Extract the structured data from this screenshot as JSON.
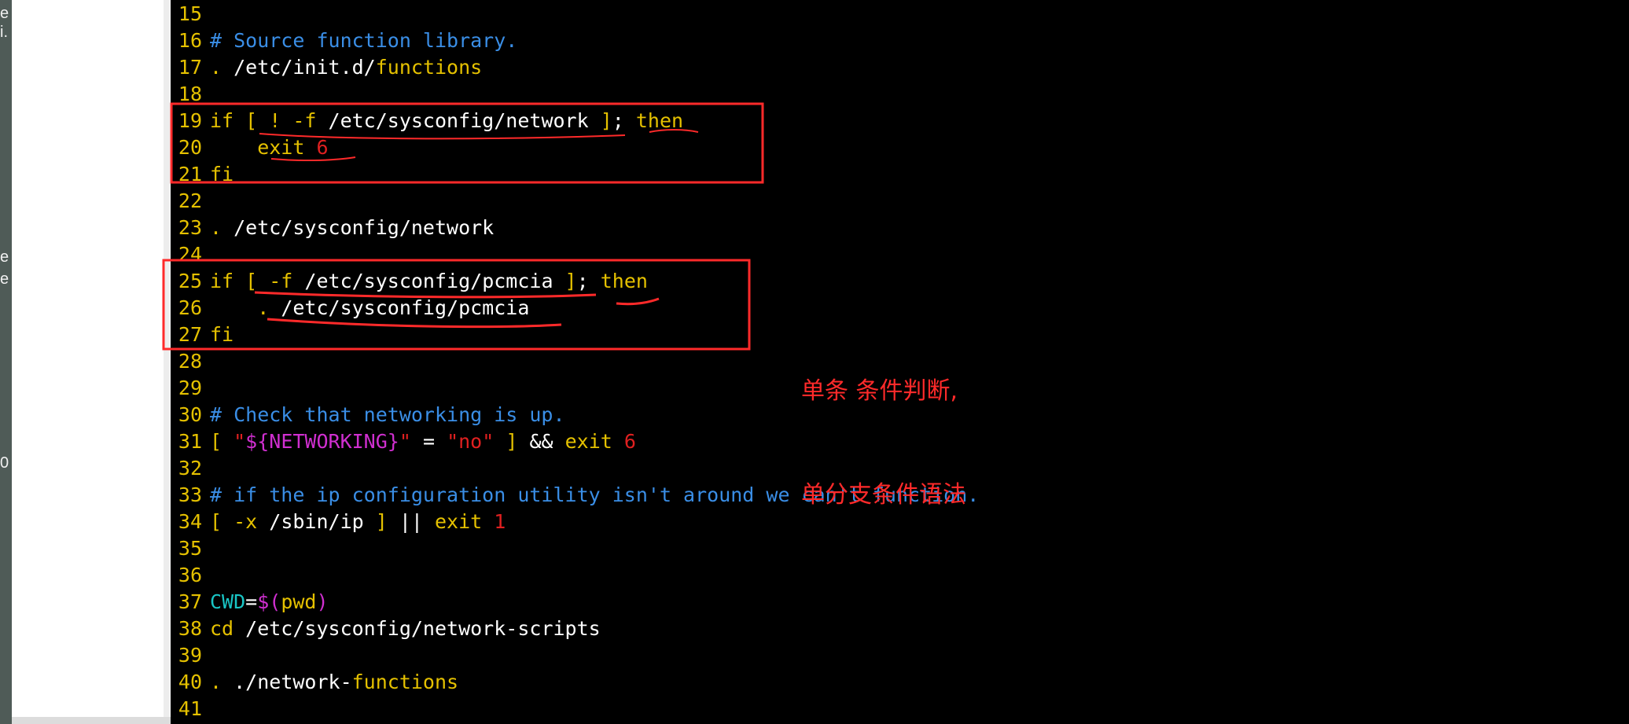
{
  "left_fragments": [
    {
      "text": "e"
    },
    {
      "text": "i."
    },
    {
      "text": "e"
    },
    {
      "text": "e"
    },
    {
      "text": "0"
    }
  ],
  "lines": [
    {
      "num": "15",
      "segs": []
    },
    {
      "num": "16",
      "segs": [
        {
          "t": "# Source function library.",
          "c": "c-blue"
        }
      ]
    },
    {
      "num": "17",
      "segs": [
        {
          "t": ". ",
          "c": "c-yellow"
        },
        {
          "t": "/etc/init.d/",
          "c": "c-white"
        },
        {
          "t": "functions",
          "c": "c-yellow"
        }
      ]
    },
    {
      "num": "18",
      "segs": []
    },
    {
      "num": "19",
      "segs": [
        {
          "t": "if ",
          "c": "c-yellow"
        },
        {
          "t": "[ ! -f ",
          "c": "c-yellow"
        },
        {
          "t": "/etc/sysconfig/network",
          "c": "c-white"
        },
        {
          "t": " ]",
          "c": "c-yellow"
        },
        {
          "t": "; ",
          "c": "c-white"
        },
        {
          "t": "then",
          "c": "c-yellow"
        }
      ]
    },
    {
      "num": "20",
      "segs": [
        {
          "t": "    exit ",
          "c": "c-yellow"
        },
        {
          "t": "6",
          "c": "c-red"
        }
      ]
    },
    {
      "num": "21",
      "segs": [
        {
          "t": "fi",
          "c": "c-yellow"
        }
      ]
    },
    {
      "num": "22",
      "segs": []
    },
    {
      "num": "23",
      "segs": [
        {
          "t": ". ",
          "c": "c-yellow"
        },
        {
          "t": "/etc/sysconfig/network",
          "c": "c-white"
        }
      ]
    },
    {
      "num": "24",
      "segs": []
    },
    {
      "num": "25",
      "segs": [
        {
          "t": "if ",
          "c": "c-yellow"
        },
        {
          "t": "[ -f ",
          "c": "c-yellow"
        },
        {
          "t": "/etc/sysconfig/pcmcia",
          "c": "c-white"
        },
        {
          "t": " ]",
          "c": "c-yellow"
        },
        {
          "t": "; ",
          "c": "c-white"
        },
        {
          "t": "then",
          "c": "c-yellow"
        }
      ]
    },
    {
      "num": "26",
      "segs": [
        {
          "t": "    . ",
          "c": "c-yellow"
        },
        {
          "t": "/etc/sysconfig/pcmcia",
          "c": "c-white"
        }
      ]
    },
    {
      "num": "27",
      "segs": [
        {
          "t": "fi",
          "c": "c-yellow"
        }
      ]
    },
    {
      "num": "28",
      "segs": []
    },
    {
      "num": "29",
      "segs": []
    },
    {
      "num": "30",
      "segs": [
        {
          "t": "# Check that networking is up.",
          "c": "c-blue"
        }
      ]
    },
    {
      "num": "31",
      "segs": [
        {
          "t": "[ ",
          "c": "c-yellow"
        },
        {
          "t": "\"",
          "c": "c-red"
        },
        {
          "t": "${NETWORKING}",
          "c": "c-magenta"
        },
        {
          "t": "\"",
          "c": "c-red"
        },
        {
          "t": " = ",
          "c": "c-white"
        },
        {
          "t": "\"no\"",
          "c": "c-red"
        },
        {
          "t": " ] ",
          "c": "c-yellow"
        },
        {
          "t": "&& ",
          "c": "c-white"
        },
        {
          "t": "exit ",
          "c": "c-yellow"
        },
        {
          "t": "6",
          "c": "c-red"
        }
      ]
    },
    {
      "num": "32",
      "segs": []
    },
    {
      "num": "33",
      "segs": [
        {
          "t": "# if the ip configuration utility isn't around we can't function.",
          "c": "c-blue"
        }
      ]
    },
    {
      "num": "34",
      "segs": [
        {
          "t": "[ -x ",
          "c": "c-yellow"
        },
        {
          "t": "/sbin/ip",
          "c": "c-white"
        },
        {
          "t": " ] ",
          "c": "c-yellow"
        },
        {
          "t": "|| ",
          "c": "c-white"
        },
        {
          "t": "exit ",
          "c": "c-yellow"
        },
        {
          "t": "1",
          "c": "c-red"
        }
      ]
    },
    {
      "num": "35",
      "segs": []
    },
    {
      "num": "36",
      "segs": []
    },
    {
      "num": "37",
      "segs": [
        {
          "t": "CWD",
          "c": "c-cyan"
        },
        {
          "t": "=",
          "c": "c-white"
        },
        {
          "t": "$(",
          "c": "c-magenta"
        },
        {
          "t": "pwd",
          "c": "c-yellow"
        },
        {
          "t": ")",
          "c": "c-magenta"
        }
      ]
    },
    {
      "num": "38",
      "segs": [
        {
          "t": "cd ",
          "c": "c-yellow"
        },
        {
          "t": "/etc/sysconfig/network-scripts",
          "c": "c-white"
        }
      ]
    },
    {
      "num": "39",
      "segs": []
    },
    {
      "num": "40",
      "segs": [
        {
          "t": ". ",
          "c": "c-yellow"
        },
        {
          "t": "./network-",
          "c": "c-white"
        },
        {
          "t": "functions",
          "c": "c-yellow"
        }
      ]
    },
    {
      "num": "41",
      "segs": []
    }
  ],
  "annotation": {
    "line1": "单条 条件判断,",
    "line2": "单分支条件语法",
    "color": "#ff2a2a"
  },
  "colors": {
    "terminal_bg": "#000000",
    "keyword": "#e5c100",
    "comment": "#3a8ee6",
    "number": "#e02020",
    "variable": "#d02fd0",
    "cyan": "#19c5c5",
    "annotation": "#ff2a2a"
  }
}
